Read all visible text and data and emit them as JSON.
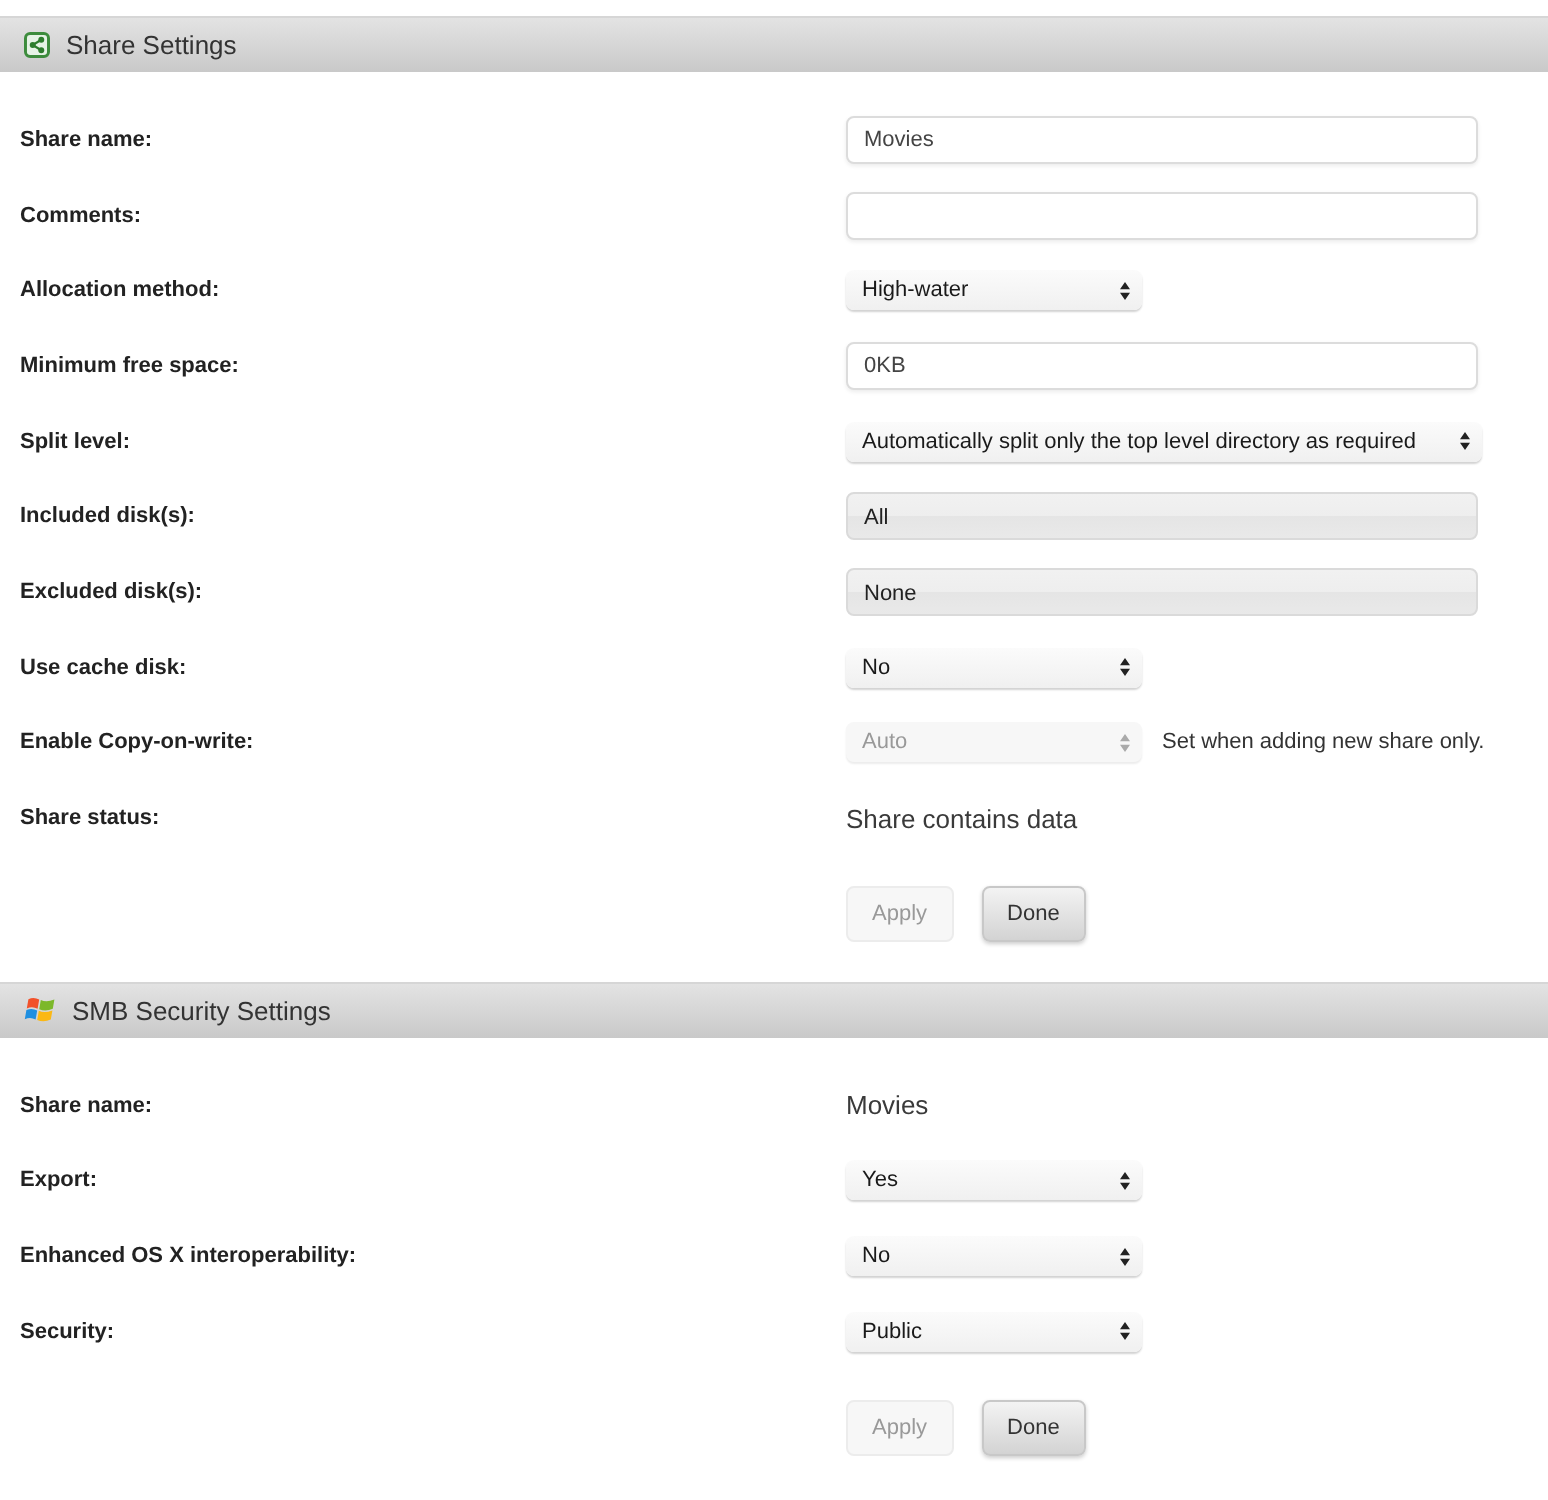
{
  "share_settings": {
    "title": "Share Settings",
    "rows": [
      {
        "kind": "input",
        "label": "Share name:",
        "value": "Movies"
      },
      {
        "kind": "input",
        "label": "Comments:"
      },
      {
        "kind": "select",
        "label": "Allocation method:",
        "value": "High-water",
        "disabled": false
      },
      {
        "kind": "input",
        "label": "Minimum free space:",
        "value": "0KB"
      },
      {
        "kind": "longselect",
        "label": "Split level:",
        "value": "Automatically split only the top level directory as required",
        "disabled": false
      },
      {
        "kind": "picker",
        "label": "Included disk(s):",
        "value": "All"
      },
      {
        "kind": "picker",
        "label": "Excluded disk(s):",
        "value": "None"
      },
      {
        "kind": "select",
        "label": "Use cache disk:",
        "value": "No",
        "disabled": false
      },
      {
        "kind": "select",
        "label": "Enable Copy-on-write:",
        "value": "Auto",
        "disabled": true,
        "note": "Set when adding new share only."
      },
      {
        "kind": "text",
        "label": "Share status:",
        "value": "Share contains data"
      }
    ],
    "buttons": [
      {
        "label": "Apply",
        "disabled": true
      },
      {
        "label": "Done",
        "disabled": false
      }
    ]
  },
  "smb_security_settings": {
    "title": "SMB Security Settings",
    "rows": [
      {
        "kind": "text",
        "label": "Share name:",
        "value": "Movies"
      },
      {
        "kind": "select",
        "label": "Export:",
        "value": "Yes",
        "disabled": false
      },
      {
        "kind": "select",
        "label": "Enhanced OS X interoperability:",
        "value": "No",
        "disabled": false
      },
      {
        "kind": "select",
        "label": "Security:",
        "value": "Public",
        "disabled": false
      }
    ],
    "buttons": [
      {
        "label": "Apply",
        "disabled": true
      },
      {
        "label": "Done",
        "disabled": false
      }
    ]
  }
}
